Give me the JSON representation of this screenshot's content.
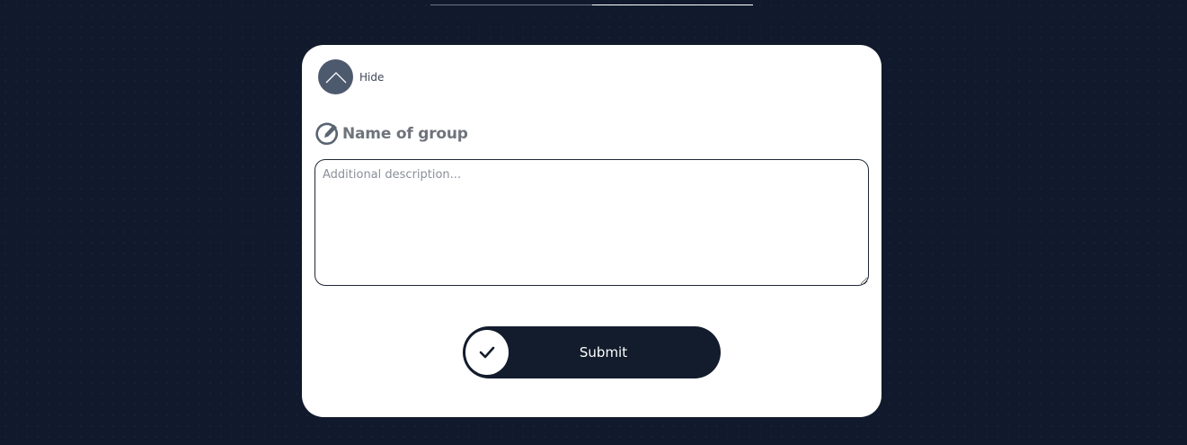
{
  "top_tabs": {
    "items": [
      "",
      ""
    ]
  },
  "panel": {
    "toggle": {
      "label": "Hide",
      "icon": "chevron-up-icon"
    },
    "group": {
      "name": "Name of group",
      "icon": "edit-pencil-icon"
    },
    "description": {
      "value": "",
      "placeholder": "Additional description..."
    },
    "submit": {
      "label": "Submit",
      "icon": "check-icon"
    }
  },
  "colors": {
    "background": "#111a2c",
    "card": "#ffffff",
    "toggle_circle": "#4d596d",
    "button": "#131c2c",
    "title_text": "#6f737b"
  }
}
